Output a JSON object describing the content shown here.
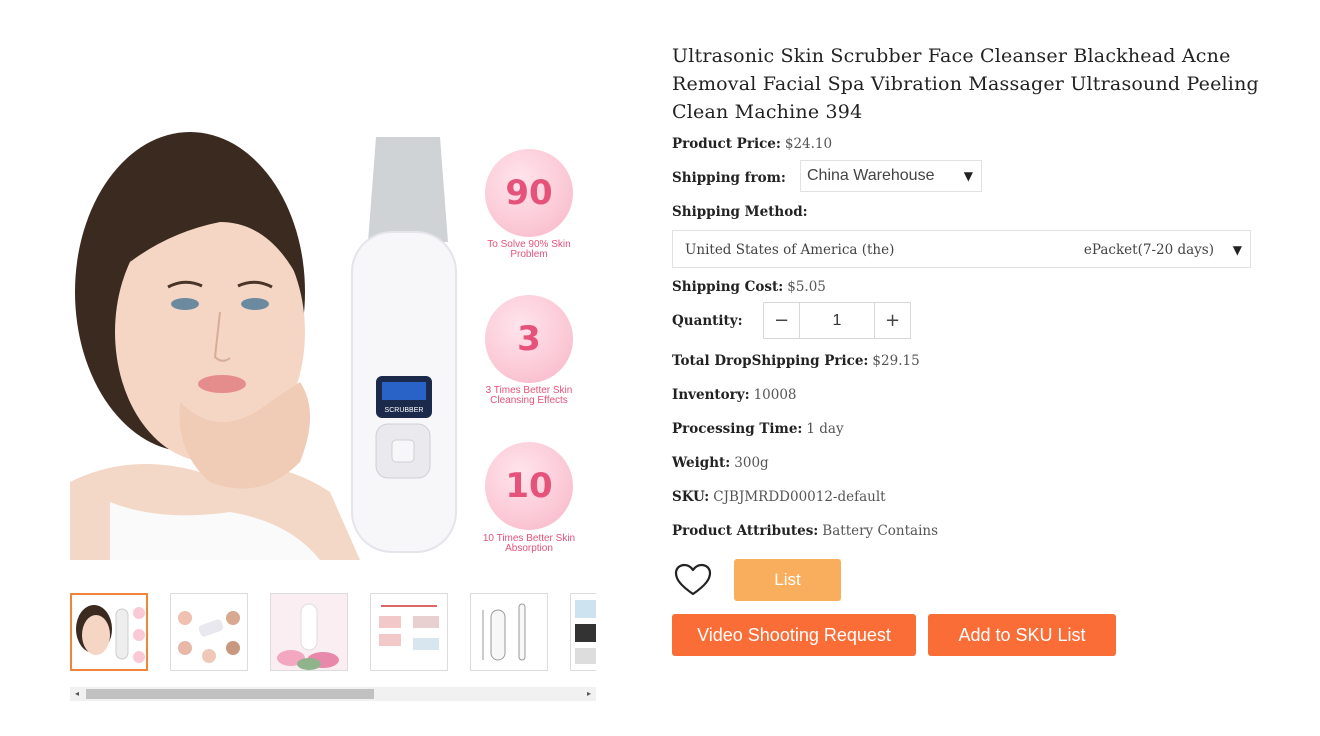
{
  "product": {
    "title": "Ultrasonic Skin Scrubber Face Cleanser Blackhead Acne Removal Facial Spa Vibration Massager Ultrasound Peeling Clean Machine 394",
    "price_label": "Product Price:",
    "price": "$24.10",
    "shipping_from_label": "Shipping from:",
    "shipping_from": "China Warehouse",
    "shipping_method_label": "Shipping Method:",
    "shipping_country": "United States of America (the)",
    "shipping_method": "ePacket(7-20 days)",
    "shipping_cost_label": "Shipping Cost:",
    "shipping_cost": "$5.05",
    "quantity_label": "Quantity:",
    "quantity": "1",
    "total_label": "Total DropShipping Price:",
    "total": "$29.15",
    "inventory_label": "Inventory:",
    "inventory": "10008",
    "processing_label": "Processing Time:",
    "processing": "1 day",
    "weight_label": "Weight:",
    "weight": "300g",
    "sku_label": "SKU:",
    "sku": "CJBJMRDD00012-default",
    "attributes_label": "Product Attributes:",
    "attributes": "Battery Contains"
  },
  "image": {
    "bubbles": [
      {
        "number": "90",
        "caption": "To Solve 90% Skin Problem"
      },
      {
        "number": "3",
        "caption": "3 Times Better Skin Cleansing Effects"
      },
      {
        "number": "10",
        "caption": "10 Times Better Skin Absorption"
      }
    ],
    "device_label": "SCRUBBER"
  },
  "actions": {
    "list": "List",
    "video": "Video Shooting Request",
    "add_sku": "Add to SKU List"
  },
  "icons": {
    "wishlist": "heart-icon",
    "select_caret": "caret-down-icon",
    "minus": "minus-icon",
    "plus": "plus-icon"
  },
  "colors": {
    "accent_orange": "#fb6d37",
    "list_orange": "#f8ae5c",
    "active_thumb_border": "#f0843a",
    "bubble_pink": "#e5527a"
  }
}
